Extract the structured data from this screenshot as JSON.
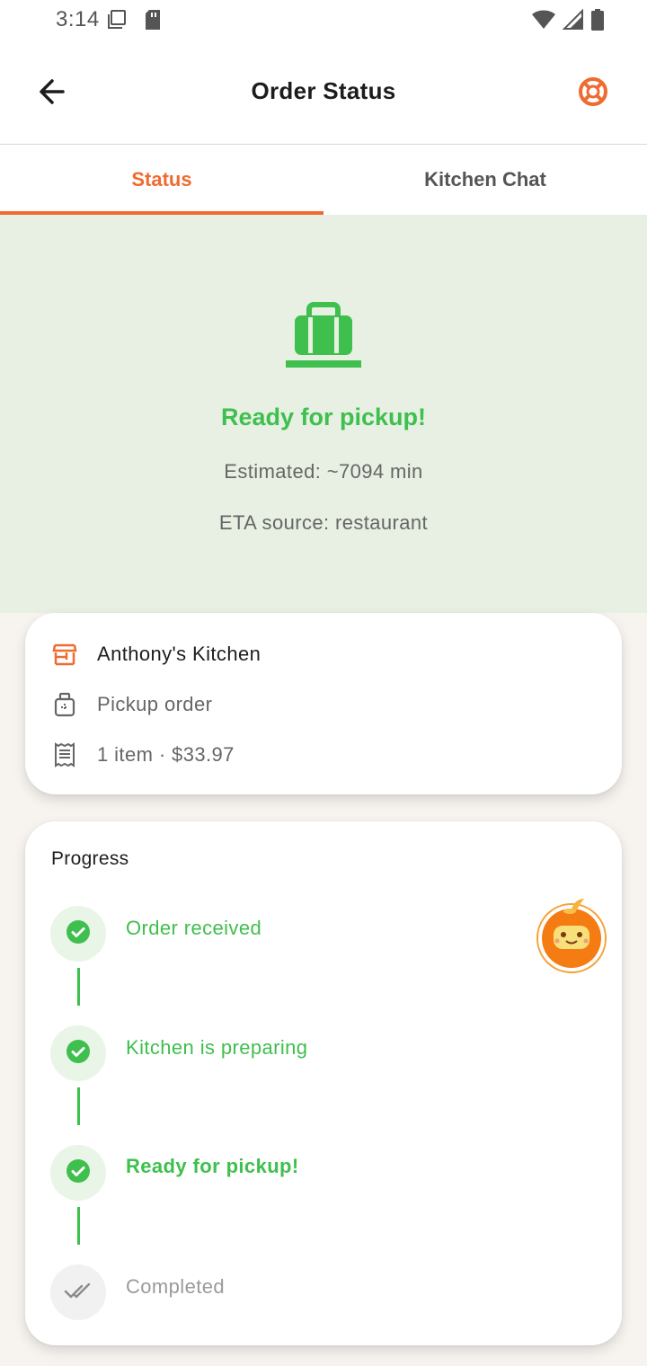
{
  "status_bar": {
    "time": "3:14"
  },
  "app_bar": {
    "title": "Order Status",
    "back_icon": "arrow-back-icon",
    "help_icon": "lifebuoy-icon"
  },
  "tabs": [
    {
      "label": "Status",
      "active": true
    },
    {
      "label": "Kitchen Chat",
      "active": false
    }
  ],
  "hero": {
    "icon": "shopping-bag-icon",
    "title": "Ready for pickup!",
    "estimate": "Estimated: ~7094 min",
    "eta_source": "ETA source: restaurant"
  },
  "info": {
    "restaurant": "Anthony's Kitchen",
    "order_type": "Pickup order",
    "summary": "1 item · $33.97"
  },
  "progress": {
    "title": "Progress",
    "steps": [
      {
        "label": "Order received",
        "state": "done"
      },
      {
        "label": "Kitchen is preparing",
        "state": "done"
      },
      {
        "label": "Ready for pickup!",
        "state": "current"
      },
      {
        "label": "Completed",
        "state": "pending"
      }
    ]
  },
  "colors": {
    "accent": "#ef6b30",
    "success": "#3fbf4e",
    "hero_bg": "#e7f0e3",
    "page_bg": "#f7f4f0"
  }
}
